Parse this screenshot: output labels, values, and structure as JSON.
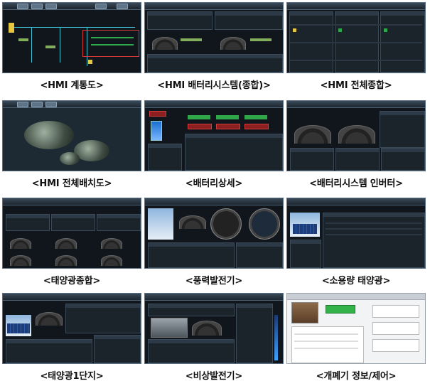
{
  "captions": [
    "<HMI 계통도>",
    "<HMI 배터리시스템(종합)>",
    "<HMI 전체종합>",
    "<HMI 전체배치도>",
    "<배터리상세>",
    "<배터리시스템 인버터>",
    "<태양광종합>",
    "<풍력발전기>",
    "<소용량 태양광>",
    "<태양광1단지>",
    "<비상발전기>",
    "<개폐기 정보/제어>"
  ]
}
